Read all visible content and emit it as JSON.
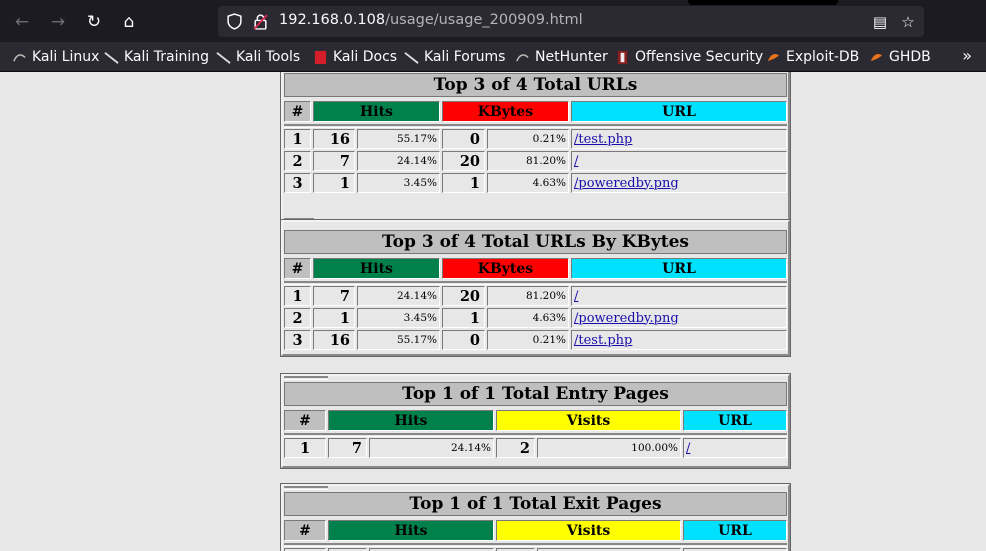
{
  "browser": {
    "url_host": "192.168.0.108",
    "url_path": "/usage/usage_200909.html",
    "bookmarks": [
      "Kali Linux",
      "Kali Training",
      "Kali Tools",
      "Kali Docs",
      "Kali Forums",
      "NetHunter",
      "Offensive Security",
      "Exploit-DB",
      "GHDB"
    ],
    "more": "»"
  },
  "colors": {
    "hits": "#00804a",
    "kbytes": "#ff0000",
    "url": "#00e0ff",
    "visits": "#ffff00",
    "header": "#bfbfbf"
  },
  "tables": [
    {
      "title": "Top 3 of 4 Total URLs",
      "columns": [
        "#",
        "Hits",
        "KBytes",
        "URL"
      ],
      "rows": [
        {
          "idx": "1",
          "hits": "16",
          "hits_pct": "55.17%",
          "kb": "0",
          "kb_pct": "0.21%",
          "url": "/test.php"
        },
        {
          "idx": "2",
          "hits": "7",
          "hits_pct": "24.14%",
          "kb": "20",
          "kb_pct": "81.20%",
          "url": "/"
        },
        {
          "idx": "3",
          "hits": "1",
          "hits_pct": "3.45%",
          "kb": "1",
          "kb_pct": "4.63%",
          "url": "/poweredby.png"
        }
      ]
    },
    {
      "title": "Top 3 of 4 Total URLs By KBytes",
      "columns": [
        "#",
        "Hits",
        "KBytes",
        "URL"
      ],
      "rows": [
        {
          "idx": "1",
          "hits": "7",
          "hits_pct": "24.14%",
          "kb": "20",
          "kb_pct": "81.20%",
          "url": "/"
        },
        {
          "idx": "2",
          "hits": "1",
          "hits_pct": "3.45%",
          "kb": "1",
          "kb_pct": "4.63%",
          "url": "/poweredby.png"
        },
        {
          "idx": "3",
          "hits": "16",
          "hits_pct": "55.17%",
          "kb": "0",
          "kb_pct": "0.21%",
          "url": "/test.php"
        }
      ]
    },
    {
      "title": "Top 1 of 1 Total Entry Pages",
      "columns": [
        "#",
        "Hits",
        "Visits",
        "URL"
      ],
      "rows": [
        {
          "idx": "1",
          "hits": "7",
          "hits_pct": "24.14%",
          "visits": "2",
          "visits_pct": "100.00%",
          "url": "/"
        }
      ]
    },
    {
      "title": "Top 1 of 1 Total Exit Pages",
      "columns": [
        "#",
        "Hits",
        "Visits",
        "URL"
      ],
      "rows": []
    }
  ]
}
